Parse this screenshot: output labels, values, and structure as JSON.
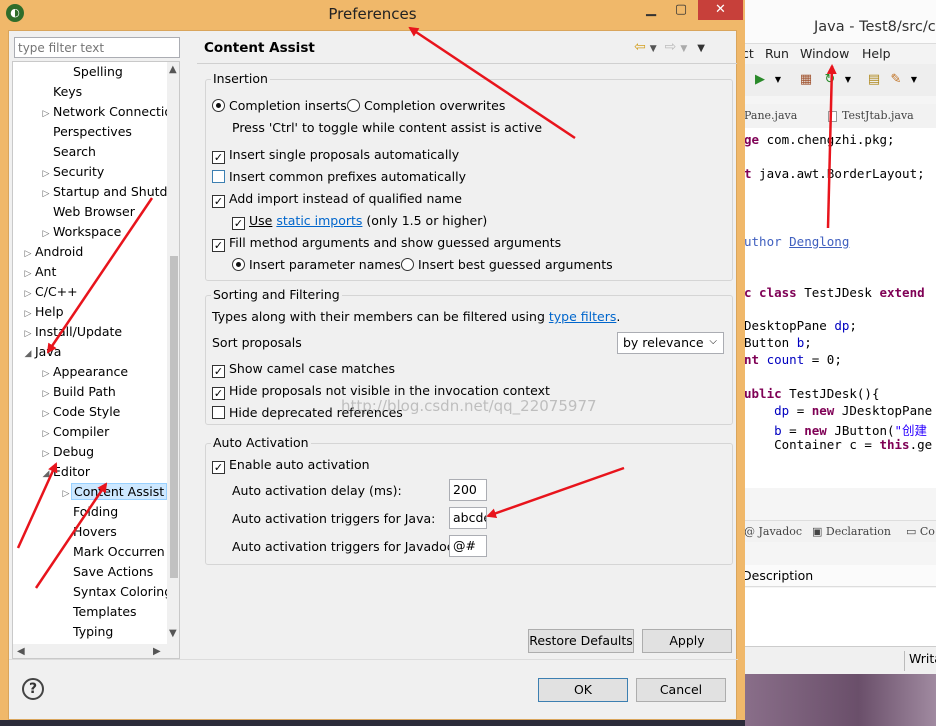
{
  "dialog": {
    "title": "Preferences",
    "filter_placeholder": "type filter text",
    "page_title": "Content Assist",
    "tree": [
      {
        "label": "Spelling",
        "level": 2,
        "twisty": ""
      },
      {
        "label": "Keys",
        "level": 1,
        "twisty": ""
      },
      {
        "label": "Network Connectio",
        "level": 1,
        "twisty": "▷"
      },
      {
        "label": "Perspectives",
        "level": 1,
        "twisty": ""
      },
      {
        "label": "Search",
        "level": 1,
        "twisty": ""
      },
      {
        "label": "Security",
        "level": 1,
        "twisty": "▷"
      },
      {
        "label": "Startup and Shutd",
        "level": 1,
        "twisty": "▷"
      },
      {
        "label": "Web Browser",
        "level": 1,
        "twisty": ""
      },
      {
        "label": "Workspace",
        "level": 1,
        "twisty": "▷"
      },
      {
        "label": "Android",
        "level": 0,
        "twisty": "▷"
      },
      {
        "label": "Ant",
        "level": 0,
        "twisty": "▷"
      },
      {
        "label": "C/C++",
        "level": 0,
        "twisty": "▷"
      },
      {
        "label": "Help",
        "level": 0,
        "twisty": "▷"
      },
      {
        "label": "Install/Update",
        "level": 0,
        "twisty": "▷"
      },
      {
        "label": "Java",
        "level": 0,
        "twisty": "◢"
      },
      {
        "label": "Appearance",
        "level": 1,
        "twisty": "▷"
      },
      {
        "label": "Build Path",
        "level": 1,
        "twisty": "▷"
      },
      {
        "label": "Code Style",
        "level": 1,
        "twisty": "▷"
      },
      {
        "label": "Compiler",
        "level": 1,
        "twisty": "▷"
      },
      {
        "label": "Debug",
        "level": 1,
        "twisty": "▷"
      },
      {
        "label": "Editor",
        "level": 1,
        "twisty": "◢"
      },
      {
        "label": "Content Assist",
        "level": 2,
        "twisty": "▷",
        "selected": true
      },
      {
        "label": "Folding",
        "level": 2,
        "twisty": ""
      },
      {
        "label": "Hovers",
        "level": 2,
        "twisty": ""
      },
      {
        "label": "Mark Occurren",
        "level": 2,
        "twisty": ""
      },
      {
        "label": "Save Actions",
        "level": 2,
        "twisty": ""
      },
      {
        "label": "Syntax Coloring",
        "level": 2,
        "twisty": ""
      },
      {
        "label": "Templates",
        "level": 2,
        "twisty": ""
      },
      {
        "label": "Typing",
        "level": 2,
        "twisty": ""
      }
    ],
    "insertion": {
      "title": "Insertion",
      "completion_inserts": "Completion inserts",
      "completion_overwrites": "Completion overwrites",
      "toggle_hint": "Press 'Ctrl' to toggle while content assist is active",
      "single_proposals": "Insert single proposals automatically",
      "common_prefixes": "Insert common prefixes automatically",
      "add_import": "Add import instead of qualified name",
      "use": "Use",
      "static_imports": "static imports",
      "only_15": "(only 1.5 or higher)",
      "fill_method_args": "Fill method arguments and show guessed arguments",
      "insert_param_names": "Insert parameter names",
      "insert_best_guessed": "Insert best guessed arguments"
    },
    "sorting": {
      "title": "Sorting and Filtering",
      "types_text": "Types along with their members can be filtered using",
      "type_filters": "type filters",
      "period": ".",
      "sort_proposals": "Sort proposals",
      "sort_value": "by relevance",
      "camel_case": "Show camel case matches",
      "hide_not_visible": "Hide proposals not visible in the invocation context",
      "hide_deprecated": "Hide deprecated references"
    },
    "auto_activation": {
      "title": "Auto Activation",
      "enable": "Enable auto activation",
      "delay_label": "Auto activation delay (ms):",
      "delay_value": "200",
      "java_label": "Auto activation triggers for Java:",
      "java_value": "abcde",
      "javadoc_label": "Auto activation triggers for Javadoc:",
      "javadoc_value": "@#"
    },
    "buttons": {
      "restore_defaults": "Restore Defaults",
      "apply": "Apply",
      "ok": "OK",
      "cancel": "Cancel"
    },
    "watermark": "http://blog.csdn.net/qq_22075977"
  },
  "background_window": {
    "title": "Java - Test8/src/c",
    "menus": [
      "ct",
      "Run",
      "Window",
      "Help"
    ],
    "tabs": [
      "Pane.java",
      "TestJtab.java"
    ],
    "code": [
      {
        "text": "ge com.chengzhi.pkg;",
        "style": "pkg"
      },
      {
        "text": "",
        "style": ""
      },
      {
        "text": "t java.awt.BorderLayout;",
        "style": "imp"
      },
      {
        "text": "",
        "style": ""
      },
      {
        "text": "",
        "style": ""
      },
      {
        "text": "",
        "style": ""
      },
      {
        "text": "uthor Denglong",
        "style": "cmt"
      },
      {
        "text": "",
        "style": ""
      },
      {
        "text": "",
        "style": ""
      },
      {
        "text": "c class TestJDesk extend",
        "style": "cls"
      },
      {
        "text": "",
        "style": ""
      },
      {
        "text": "DesktopPane dp;",
        "style": "fld1"
      },
      {
        "text": "Button b;",
        "style": "fld2"
      },
      {
        "text": "nt count = 0;",
        "style": "fld3"
      },
      {
        "text": "",
        "style": ""
      },
      {
        "text": "ublic TestJDesk(){",
        "style": "ctor"
      },
      {
        "text": "    dp = new JDesktopPane",
        "style": "new1"
      },
      {
        "text": "    b = new JButton(\"创建",
        "style": "new2"
      },
      {
        "text": "    Container c = this.ge",
        "style": "cont"
      }
    ],
    "bottom_tabs": [
      "Javadoc",
      "Declaration",
      "Co"
    ],
    "description_header": "Description",
    "status": "Writa"
  }
}
